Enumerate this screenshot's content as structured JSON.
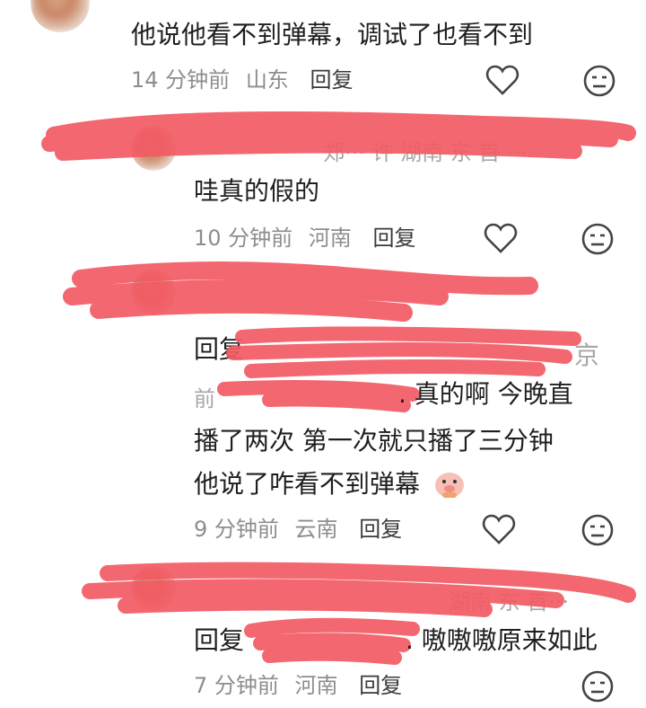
{
  "comments": [
    {
      "text": "他说他看不到弹幕，调试了也看不到",
      "time": "14 分钟前",
      "location": "山东",
      "reply_label": "回复"
    },
    {
      "text": "哇真的假的",
      "time": "10 分钟前",
      "location": "河南",
      "reply_label": "回复"
    },
    {
      "reply_prefix": "回复",
      "lines": [
        ". 真的啊 今晚直",
        "播了两次 第一次就只播了三分钟",
        "他说了咋看不到弹幕"
      ],
      "time": "9 分钟前",
      "location": "云南",
      "reply_label": "回复"
    },
    {
      "reply_prefix": "回复",
      "text": ". 嗷嗷嗷原来如此",
      "time": "7 分钟前",
      "location": "河南",
      "reply_label": "回复"
    }
  ],
  "partial_visible": {
    "name_2": "郑··· 许 湖南 东 首 ···",
    "name_3_tail": "京",
    "name_3b": "前",
    "name_4": "湖南 东 首···"
  },
  "colors": {
    "scribble": "#f25a64",
    "meta": "#8d8d8d",
    "text": "#1f1f1f"
  },
  "icons": [
    "heart-icon",
    "emoji-face-icon",
    "pig-emoji-icon"
  ]
}
